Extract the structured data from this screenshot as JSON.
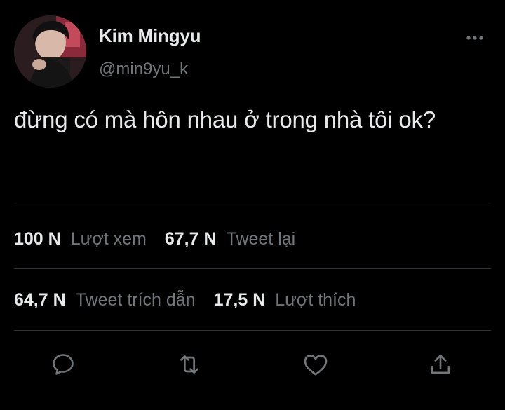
{
  "tweet": {
    "author": {
      "name": "Kim Mingyu",
      "handle": "@min9yu_k"
    },
    "text": "đừng có mà hôn nhau ở trong nhà tôi ok?",
    "stats": [
      {
        "value": "100 N",
        "label": "Lượt xem"
      },
      {
        "value": "67,7 N",
        "label": "Tweet lại"
      },
      {
        "value": "64,7 N",
        "label": "Tweet trích dẫn"
      },
      {
        "value": "17,5 N",
        "label": "Lượt thích"
      }
    ],
    "actions": [
      {
        "icon": "reply-icon"
      },
      {
        "icon": "retweet-icon"
      },
      {
        "icon": "like-icon"
      },
      {
        "icon": "share-icon"
      }
    ]
  },
  "colors": {
    "background": "#000000",
    "primary_text": "#e7e9ea",
    "secondary_text": "#71767b",
    "divider": "#2f3336"
  }
}
